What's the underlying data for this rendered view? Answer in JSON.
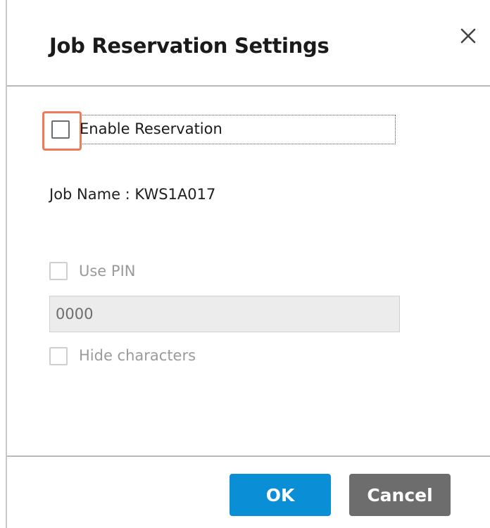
{
  "dialog": {
    "title": "Job Reservation Settings"
  },
  "enable_reservation": {
    "label": "Enable Reservation",
    "checked": false
  },
  "job_name": {
    "text": "Job Name : KWS1A017"
  },
  "use_pin": {
    "label": "Use PIN",
    "checked": false,
    "enabled": false
  },
  "pin_field": {
    "value": "0000",
    "enabled": false
  },
  "hide_characters": {
    "label": "Hide characters",
    "checked": false,
    "enabled": false
  },
  "buttons": {
    "ok_label": "OK",
    "cancel_label": "Cancel"
  },
  "colors": {
    "ok_button": "#0a8ed6",
    "cancel_button": "#6d6d6d",
    "highlight": "#f07a58"
  },
  "icons": {
    "close": "close-icon"
  }
}
